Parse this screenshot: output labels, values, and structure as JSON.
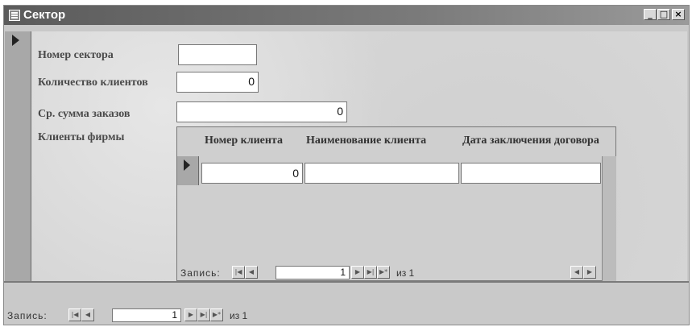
{
  "window": {
    "title": "Сектор"
  },
  "form": {
    "labels": {
      "sector_number": "Номер сектора",
      "client_count": "Количество клиентов",
      "avg_order_sum": "Ср. сумма заказов",
      "firm_clients": "Клиенты фирмы"
    },
    "values": {
      "sector_number": "",
      "client_count": "0",
      "avg_order_sum": "0"
    }
  },
  "subform": {
    "columns": [
      "Номер клиента",
      "Наименование клиента",
      "Дата заключения договора"
    ],
    "row": {
      "client_number": "0",
      "client_name": "",
      "contract_date": ""
    },
    "nav": {
      "label": "Запись:",
      "record": "1",
      "of_text": "из 1"
    }
  },
  "main_nav": {
    "label": "Запись:",
    "record": "1",
    "of_text": "из 1"
  }
}
